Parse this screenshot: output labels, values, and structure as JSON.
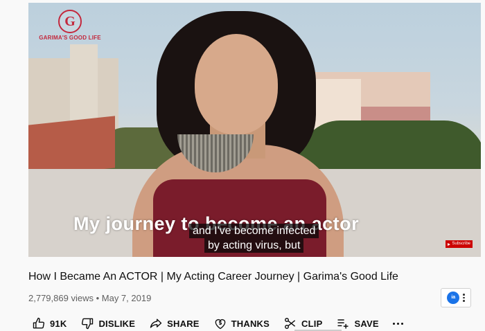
{
  "video": {
    "logo_letter": "G",
    "logo_text": "GARIMA'S GOOD LIFE",
    "burned_in_text": "My journey to become an actor",
    "captions": [
      "and I've become infected",
      "by acting virus, but"
    ],
    "watermark": "Subscribe"
  },
  "title": "How I Became An ACTOR | My Acting Career Journey | Garima's Good Life",
  "meta": {
    "views": "2,779,869 views",
    "separator": "•",
    "date": "May 7, 2019"
  },
  "extension": {
    "icon_text": "ia",
    "icon": "extension-icon"
  },
  "actions": {
    "like_count": "91K",
    "dislike": "DISLIKE",
    "share": "SHARE",
    "thanks": "THANKS",
    "clip": "CLIP",
    "save": "SAVE"
  },
  "colors": {
    "brand_red": "#c3283d",
    "background": "#f9f9f9",
    "meta_gray": "#606060"
  }
}
